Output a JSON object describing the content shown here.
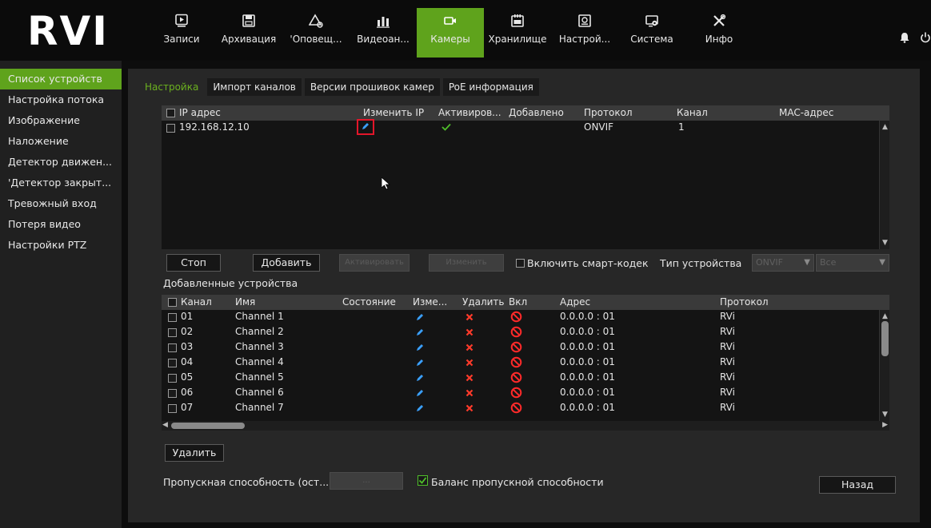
{
  "app": {
    "logo": "RVI"
  },
  "nav": [
    {
      "label": "Записи",
      "icon": "playback-icon",
      "active": false
    },
    {
      "label": "Архивация",
      "icon": "floppy-icon",
      "active": false
    },
    {
      "label": "'Оповещ...",
      "icon": "alarm-icon",
      "active": false
    },
    {
      "label": "Видеоан...",
      "icon": "analytics-icon",
      "active": false
    },
    {
      "label": "Камеры",
      "icon": "camera-icon",
      "active": true
    },
    {
      "label": "Хранилище",
      "icon": "storage-icon",
      "active": false
    },
    {
      "label": "Настрой...",
      "icon": "settings-icon",
      "active": false
    },
    {
      "label": "Система",
      "icon": "system-icon",
      "active": false
    },
    {
      "label": "Инфо",
      "icon": "tools-icon",
      "active": false
    }
  ],
  "sidebar": {
    "items": [
      {
        "label": "Список устройств",
        "active": true
      },
      {
        "label": "Настройка потока",
        "active": false
      },
      {
        "label": "Изображение",
        "active": false
      },
      {
        "label": "Наложение",
        "active": false
      },
      {
        "label": "Детектор движен...",
        "active": false
      },
      {
        "label": "'Детектор закрыт...",
        "active": false
      },
      {
        "label": "Тревожный вход",
        "active": false
      },
      {
        "label": "Потеря видео",
        "active": false
      },
      {
        "label": "Настройки PTZ",
        "active": false
      }
    ]
  },
  "tabs": [
    {
      "label": "Настройка",
      "active": true
    },
    {
      "label": "Импорт каналов",
      "active": false
    },
    {
      "label": "Версии прошивок камер",
      "active": false
    },
    {
      "label": "PoE информация",
      "active": false
    }
  ],
  "search_grid": {
    "headers": {
      "ip": "IP адрес",
      "change_ip": "Изменить IP",
      "activated": "Активиров...",
      "added": "Добавлено",
      "protocol": "Протокол",
      "channel": "Канал",
      "mac": "MAC-адрес"
    },
    "rows": [
      {
        "ip": "192.168.12.10",
        "protocol": "ONVIF",
        "channel": "1"
      }
    ]
  },
  "buttons": {
    "stop": "Стоп",
    "add": "Добавить",
    "activate": "Активировать",
    "modify": "Изменить",
    "delete": "Удалить",
    "back": "Назад",
    "bandwidth_value": "..."
  },
  "smart_codec": {
    "label": "Включить смарт-кодек",
    "checked": false
  },
  "device_type": {
    "label": "Тип устройства",
    "value1": "ONVIF",
    "value2": "Все"
  },
  "added_devices": {
    "title": "Добавленные устройства",
    "headers": {
      "channel": "Канал",
      "name": "Имя",
      "state": "Состояние",
      "edit": "Изме...",
      "delete": "Удалить",
      "enabled": "Вкл",
      "address": "Адрес",
      "protocol": "Протокол"
    },
    "rows": [
      {
        "channel": "01",
        "name": "Channel 1",
        "address": "0.0.0.0 : 01",
        "protocol": "RVi"
      },
      {
        "channel": "02",
        "name": "Channel 2",
        "address": "0.0.0.0 : 01",
        "protocol": "RVi"
      },
      {
        "channel": "03",
        "name": "Channel 3",
        "address": "0.0.0.0 : 01",
        "protocol": "RVi"
      },
      {
        "channel": "04",
        "name": "Channel 4",
        "address": "0.0.0.0 : 01",
        "protocol": "RVi"
      },
      {
        "channel": "05",
        "name": "Channel 5",
        "address": "0.0.0.0 : 01",
        "protocol": "RVi"
      },
      {
        "channel": "06",
        "name": "Channel 6",
        "address": "0.0.0.0 : 01",
        "protocol": "RVi"
      },
      {
        "channel": "07",
        "name": "Channel 7",
        "address": "0.0.0.0 : 01",
        "protocol": "RVi"
      }
    ]
  },
  "bandwidth": {
    "label": "Пропускная способность (ост...",
    "balance_label": "Баланс пропускной способности",
    "balance_checked": true
  },
  "colors": {
    "accent": "#5fa31c",
    "highlight": "#e3162a",
    "pen": "#3aa0ff",
    "delete": "#ff3a2a"
  }
}
